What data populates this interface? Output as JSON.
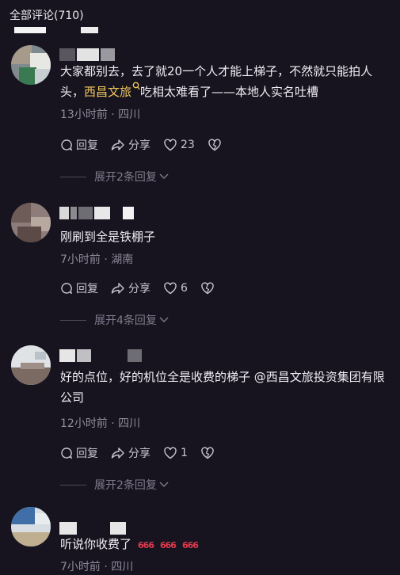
{
  "header": {
    "title": "全部评论(710)"
  },
  "comments": [
    {
      "text_before": "大家都别去，去了就20一个人才能上梯子，不然就只能拍人头，",
      "mention": "西昌文旅",
      "text_after": "吃相太难看了——本地人实名吐槽",
      "meta": "13小时前 · 四川",
      "reply_label": "回复",
      "share_label": "分享",
      "likes": "23",
      "expand_label": "展开2条回复"
    },
    {
      "text": "刚刷到全是铁棚子",
      "meta": "7小时前 · 湖南",
      "reply_label": "回复",
      "share_label": "分享",
      "likes": "6",
      "expand_label": "展开4条回复"
    },
    {
      "text": "好的点位，好的机位全是收费的梯子 @西昌文旅投资集团有限公司",
      "meta": "12小时前 · 四川",
      "reply_label": "回复",
      "share_label": "分享",
      "likes": "1",
      "expand_label": "展开2条回复"
    },
    {
      "text": "听说你收费了",
      "emoji": "666",
      "meta": "7小时前 · 四川"
    }
  ],
  "colors": {
    "background": "#171420",
    "mention": "#f1c85b",
    "emoji": "#e0394b"
  }
}
